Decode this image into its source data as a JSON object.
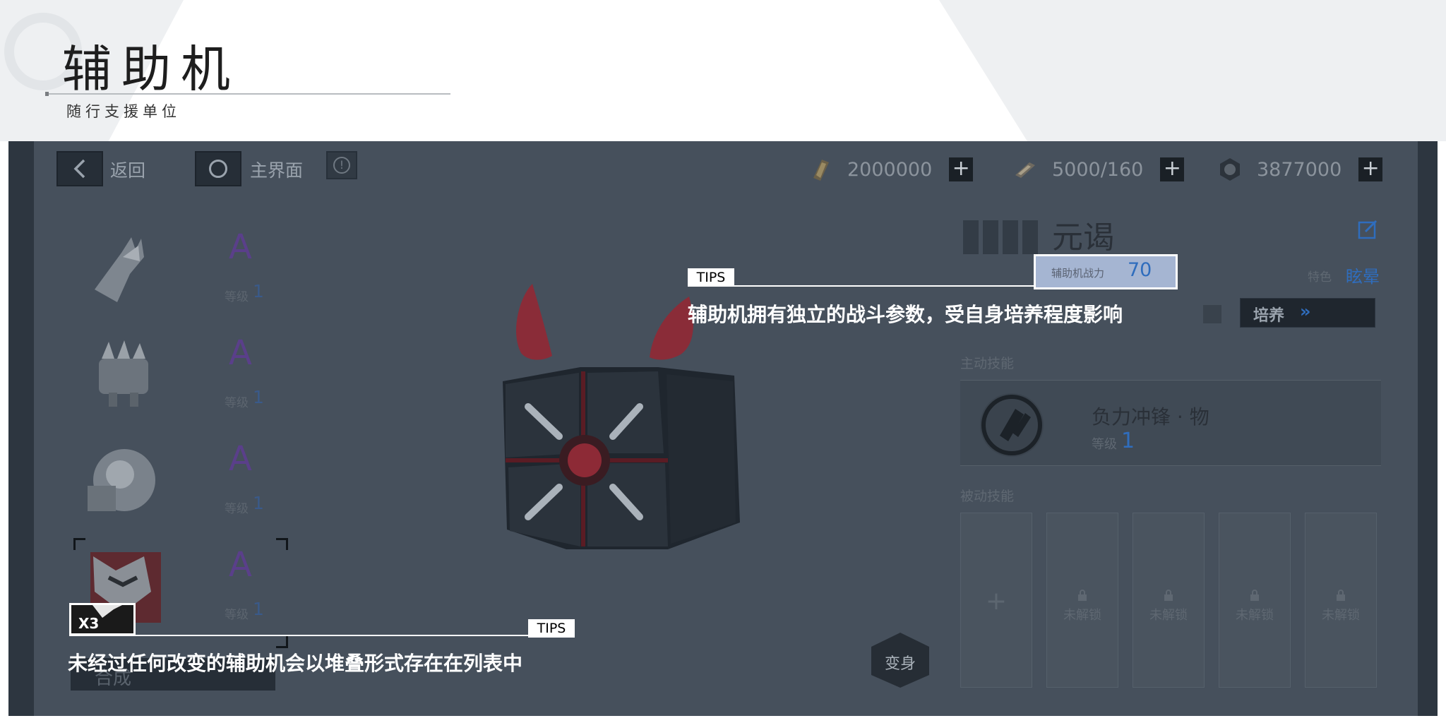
{
  "slide": {
    "title": "辅助机",
    "subtitle": "随行支援单位"
  },
  "topbar": {
    "back_label": "返回",
    "home_label": "主界面",
    "resources": [
      {
        "icon": "card-ticket-icon",
        "value": "2000000"
      },
      {
        "icon": "fuel-ammo-icon",
        "value": "5000/160"
      },
      {
        "icon": "gear-coin-icon",
        "value": "3877000"
      }
    ]
  },
  "list": {
    "items": [
      {
        "rank": "A",
        "level_label": "等级",
        "level": "1"
      },
      {
        "rank": "A",
        "level_label": "等级",
        "level": "1"
      },
      {
        "rank": "A",
        "level_label": "等级",
        "level": "1"
      },
      {
        "rank": "A",
        "level_label": "等级",
        "level": "1"
      }
    ],
    "stack_count": "X3",
    "synth_label": "合成"
  },
  "detail": {
    "name": "元谒",
    "trait_label": "特色",
    "trait_value": "眩晕",
    "train_label": "培养",
    "power_label": "辅助机战力",
    "power_value": "70",
    "active_skill_label": "主动技能",
    "skill_name": "负力冲锋 · 物",
    "skill_level_label": "等级",
    "skill_level": "1",
    "passive_skill_label": "被动技能",
    "locked_label": "未解锁",
    "transform_label": "变身"
  },
  "tips": {
    "tag": "TIPS",
    "top": "辅助机拥有独立的战斗参数，受自身培养程度影响",
    "bottom": "未经过任何改变的辅助机会以堆叠形式存在在列表中"
  },
  "colors": {
    "frame": "#46505c",
    "accent_blue": "#2f6dbd",
    "rank_purple": "#5a3f8a"
  }
}
